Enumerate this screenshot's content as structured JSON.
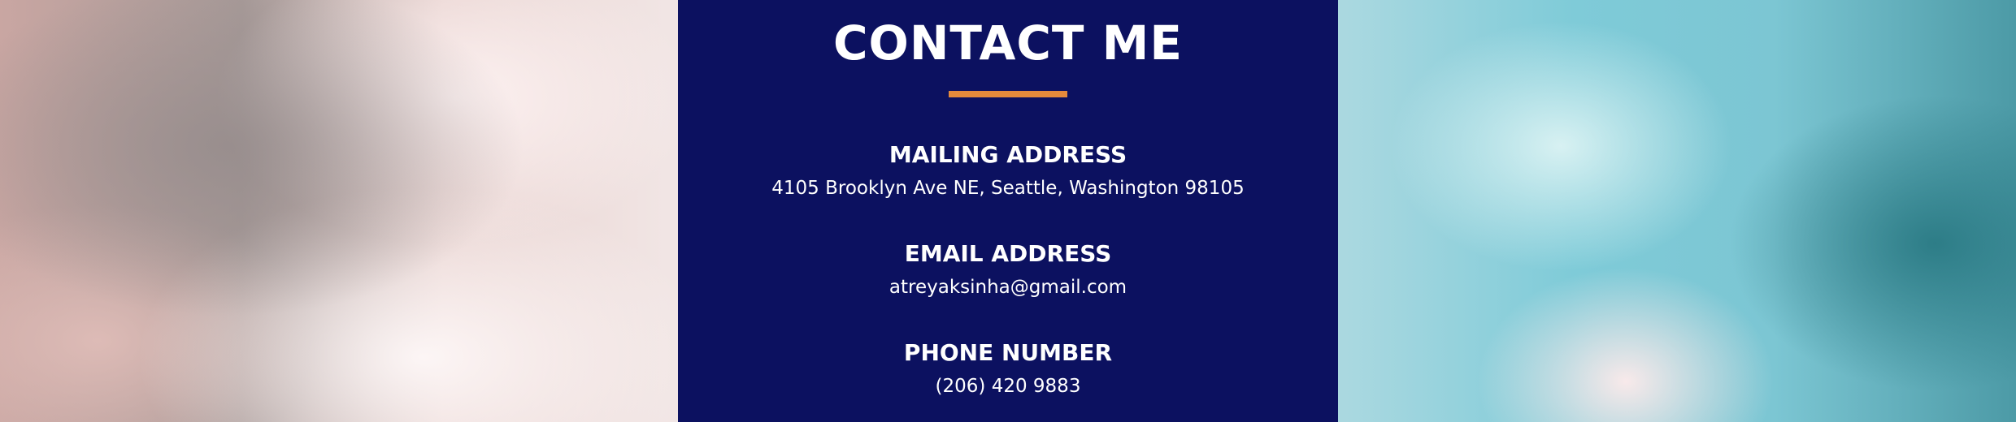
{
  "contact": {
    "title": "CONTACT ME",
    "mailing": {
      "heading": "MAILING ADDRESS",
      "value": "4105 Brooklyn Ave NE, Seattle, Washington 98105"
    },
    "email": {
      "heading": "EMAIL ADDRESS",
      "value": "atreyaksinha@gmail.com"
    },
    "phone": {
      "heading": "PHONE NUMBER",
      "value": "(206) 420 9883"
    }
  },
  "colors": {
    "panel_background": "#0c1160",
    "accent_underline": "#e58a3c",
    "text": "#ffffff"
  }
}
